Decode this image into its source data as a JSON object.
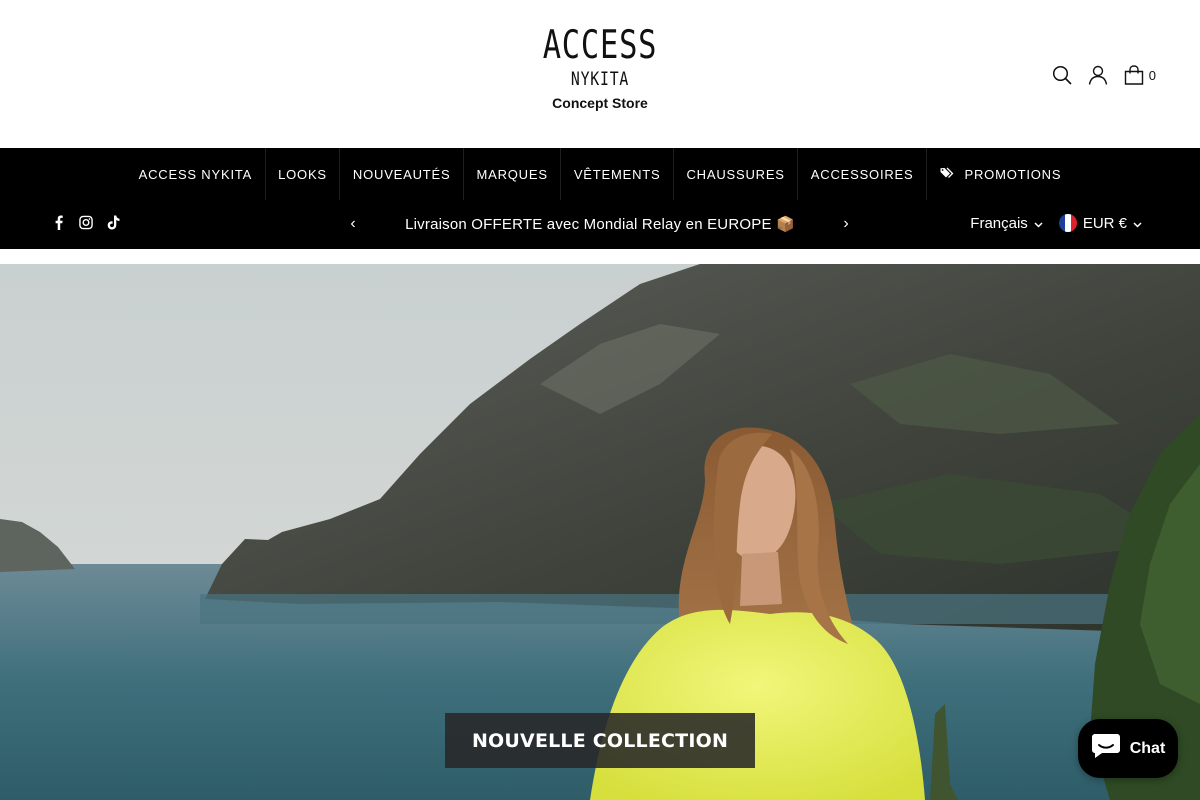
{
  "header": {
    "logo": {
      "line1": "ACCESS",
      "line2": "NYKITA",
      "line3": "Concept Store"
    },
    "icons": [
      "search-icon",
      "user-icon",
      "cart-icon"
    ],
    "cart_count": "0"
  },
  "nav": {
    "items": [
      {
        "label": "ACCESS NYKITA"
      },
      {
        "label": "LOOKS"
      },
      {
        "label": "NOUVEAUTÉS"
      },
      {
        "label": "MARQUES"
      },
      {
        "label": "VÊTEMENTS"
      },
      {
        "label": "CHAUSSURES"
      },
      {
        "label": "ACCESSOIRES"
      },
      {
        "label": "PROMOTIONS",
        "icon": "tag-icon"
      }
    ]
  },
  "announcement": {
    "social": [
      "facebook-icon",
      "instagram-icon",
      "tiktok-icon"
    ],
    "prev": "‹",
    "next": "›",
    "text": "Livraison OFFERTE avec Mondial Relay en EUROPE 📦",
    "language": "Français",
    "currency": "EUR €"
  },
  "hero": {
    "button_label": "NOUVELLE COLLECTION"
  },
  "chat": {
    "label": "Chat"
  },
  "colors": {
    "nav_bg": "#000000",
    "nav_text": "#ffffff",
    "hero_button_bg": "#2a2a2a",
    "sweater": "#e6f05a"
  }
}
